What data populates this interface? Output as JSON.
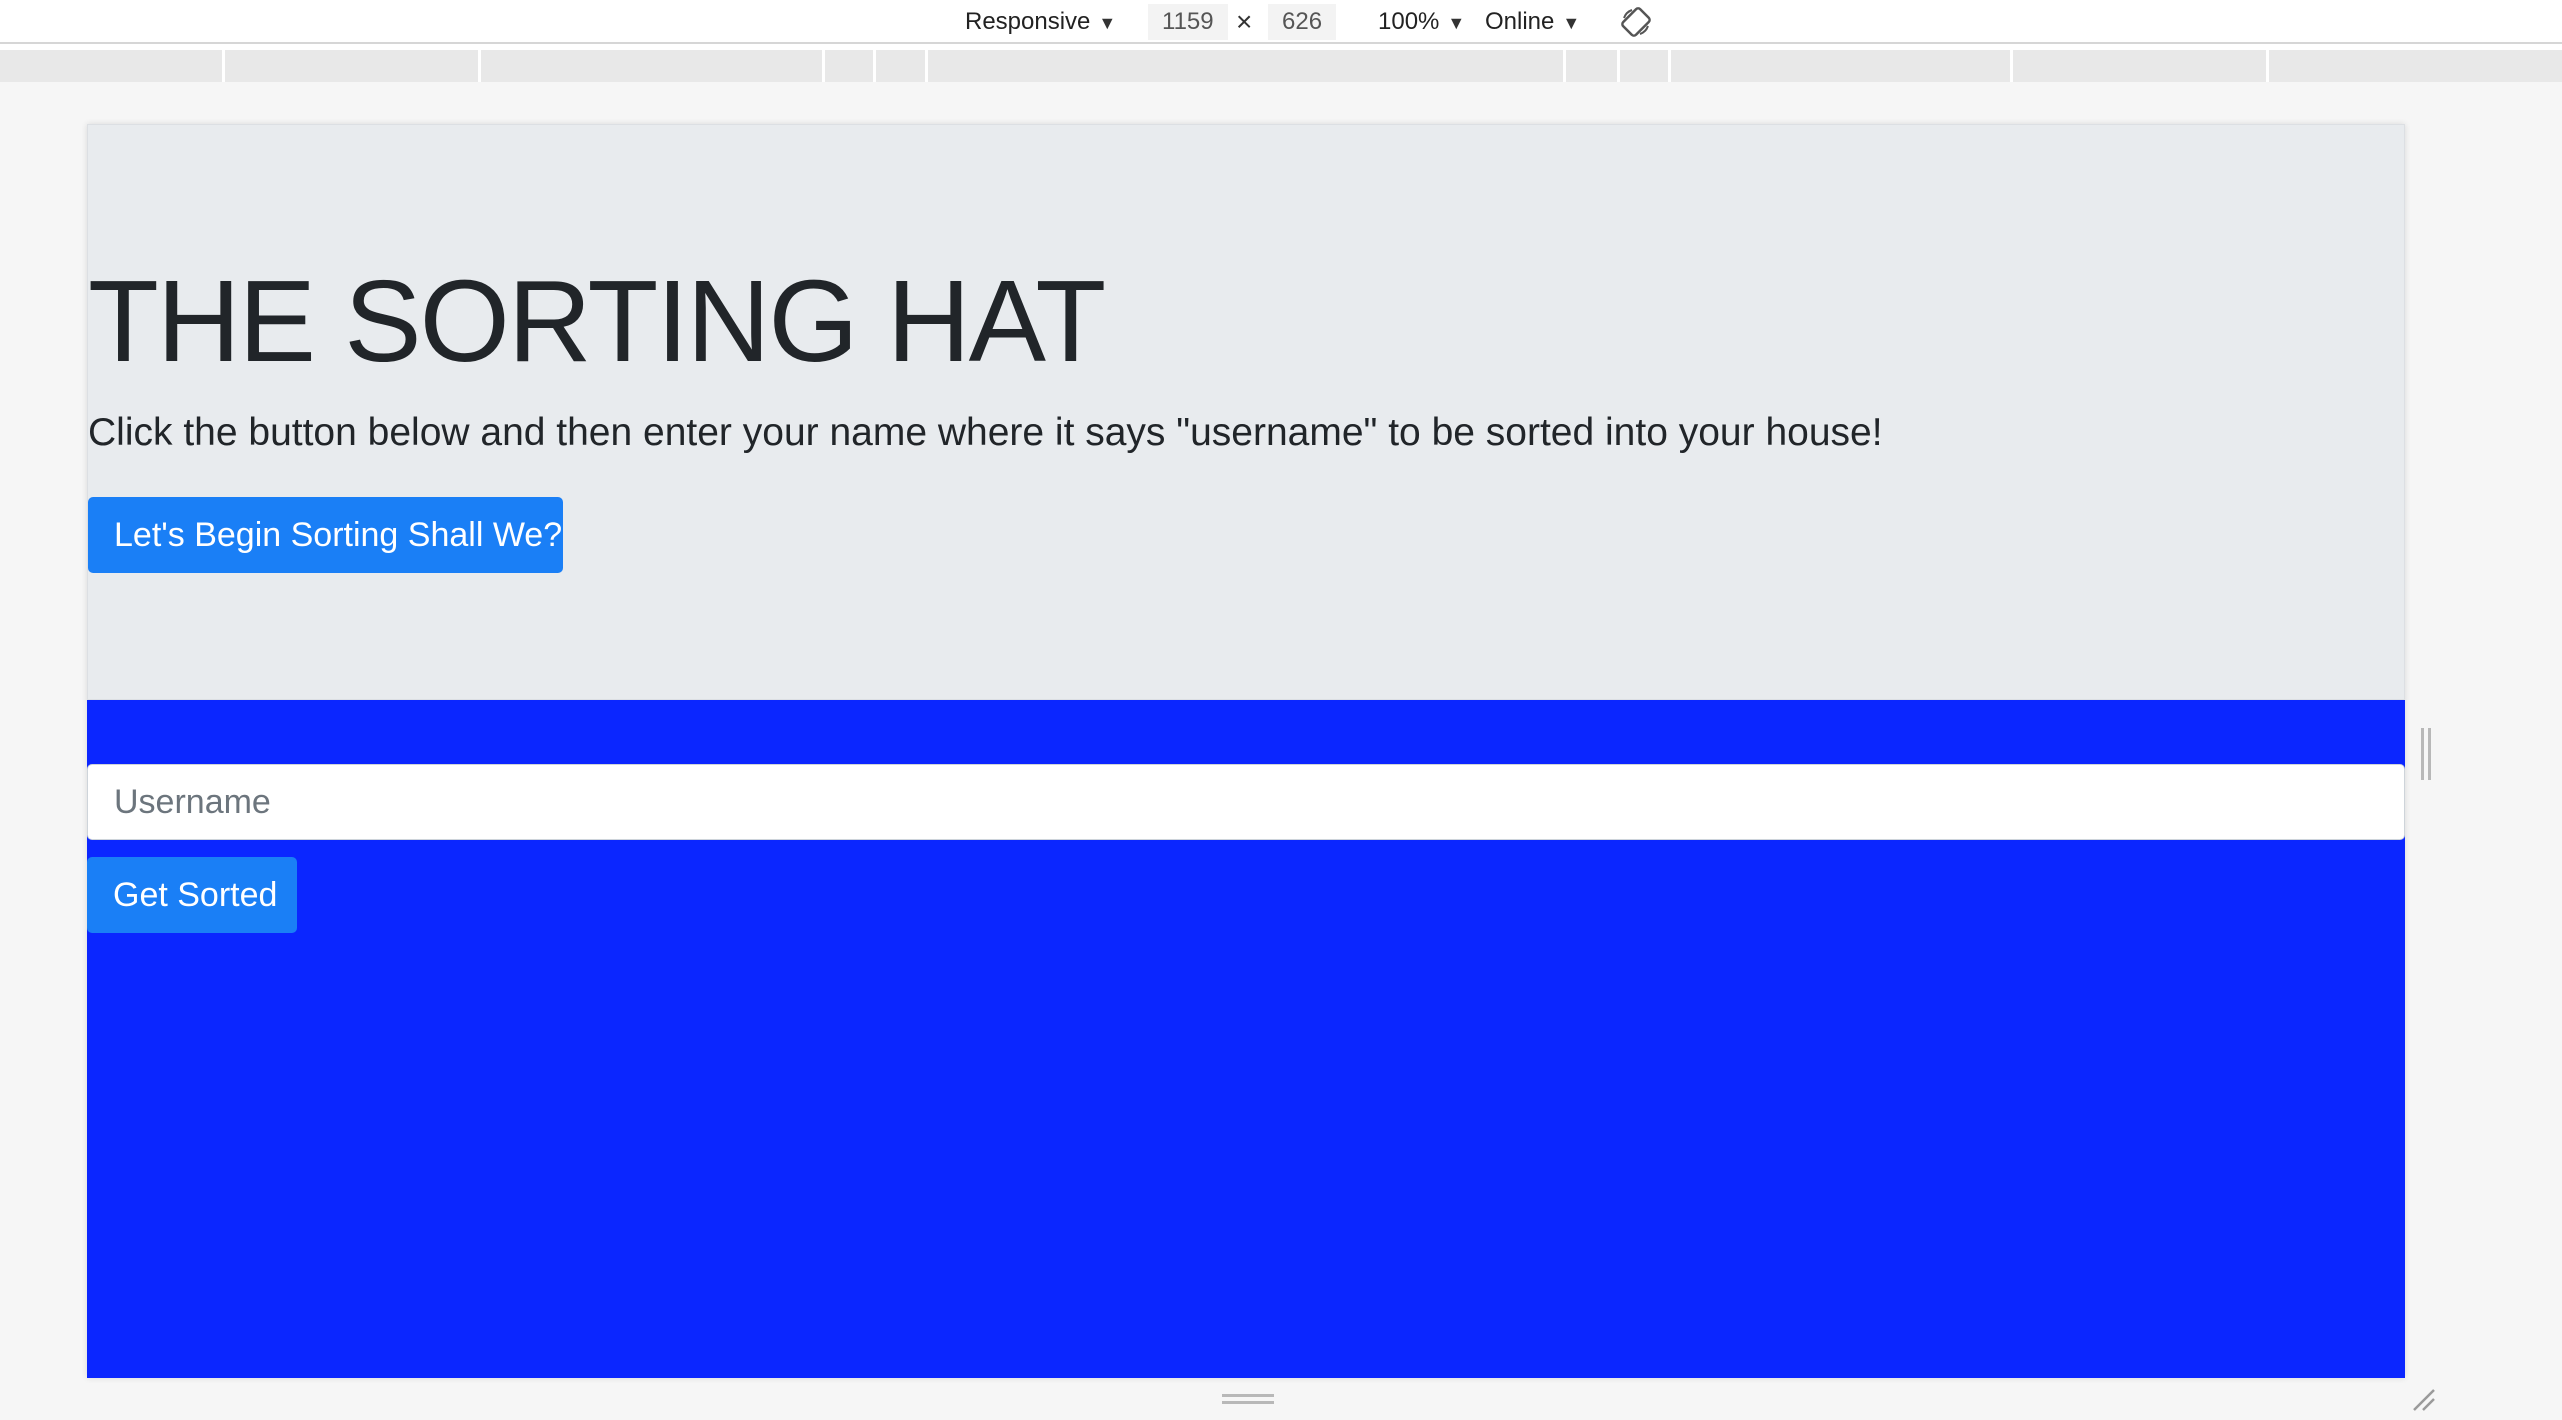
{
  "device_toolbar": {
    "device_mode": "Responsive",
    "width_value": "1159",
    "separator": "×",
    "height_value": "626",
    "zoom": "100%",
    "throttling": "Online",
    "caret_glyph": "▼",
    "rotate_icon": "rotate-icon"
  },
  "page": {
    "title": "THE SORTING HAT",
    "lead": "Click the button below and then enter your name where it says \"username\" to be sorted into your house!",
    "begin_button_label": "Let's Begin Sorting Shall We?",
    "username_placeholder": "Username",
    "username_value": "",
    "submit_button_label": "Get Sorted"
  },
  "colors": {
    "jumbotron_bg": "#e8ebee",
    "page_bg": "#0b26ff",
    "button_bg": "#1a7ff6",
    "text": "#212529"
  }
}
